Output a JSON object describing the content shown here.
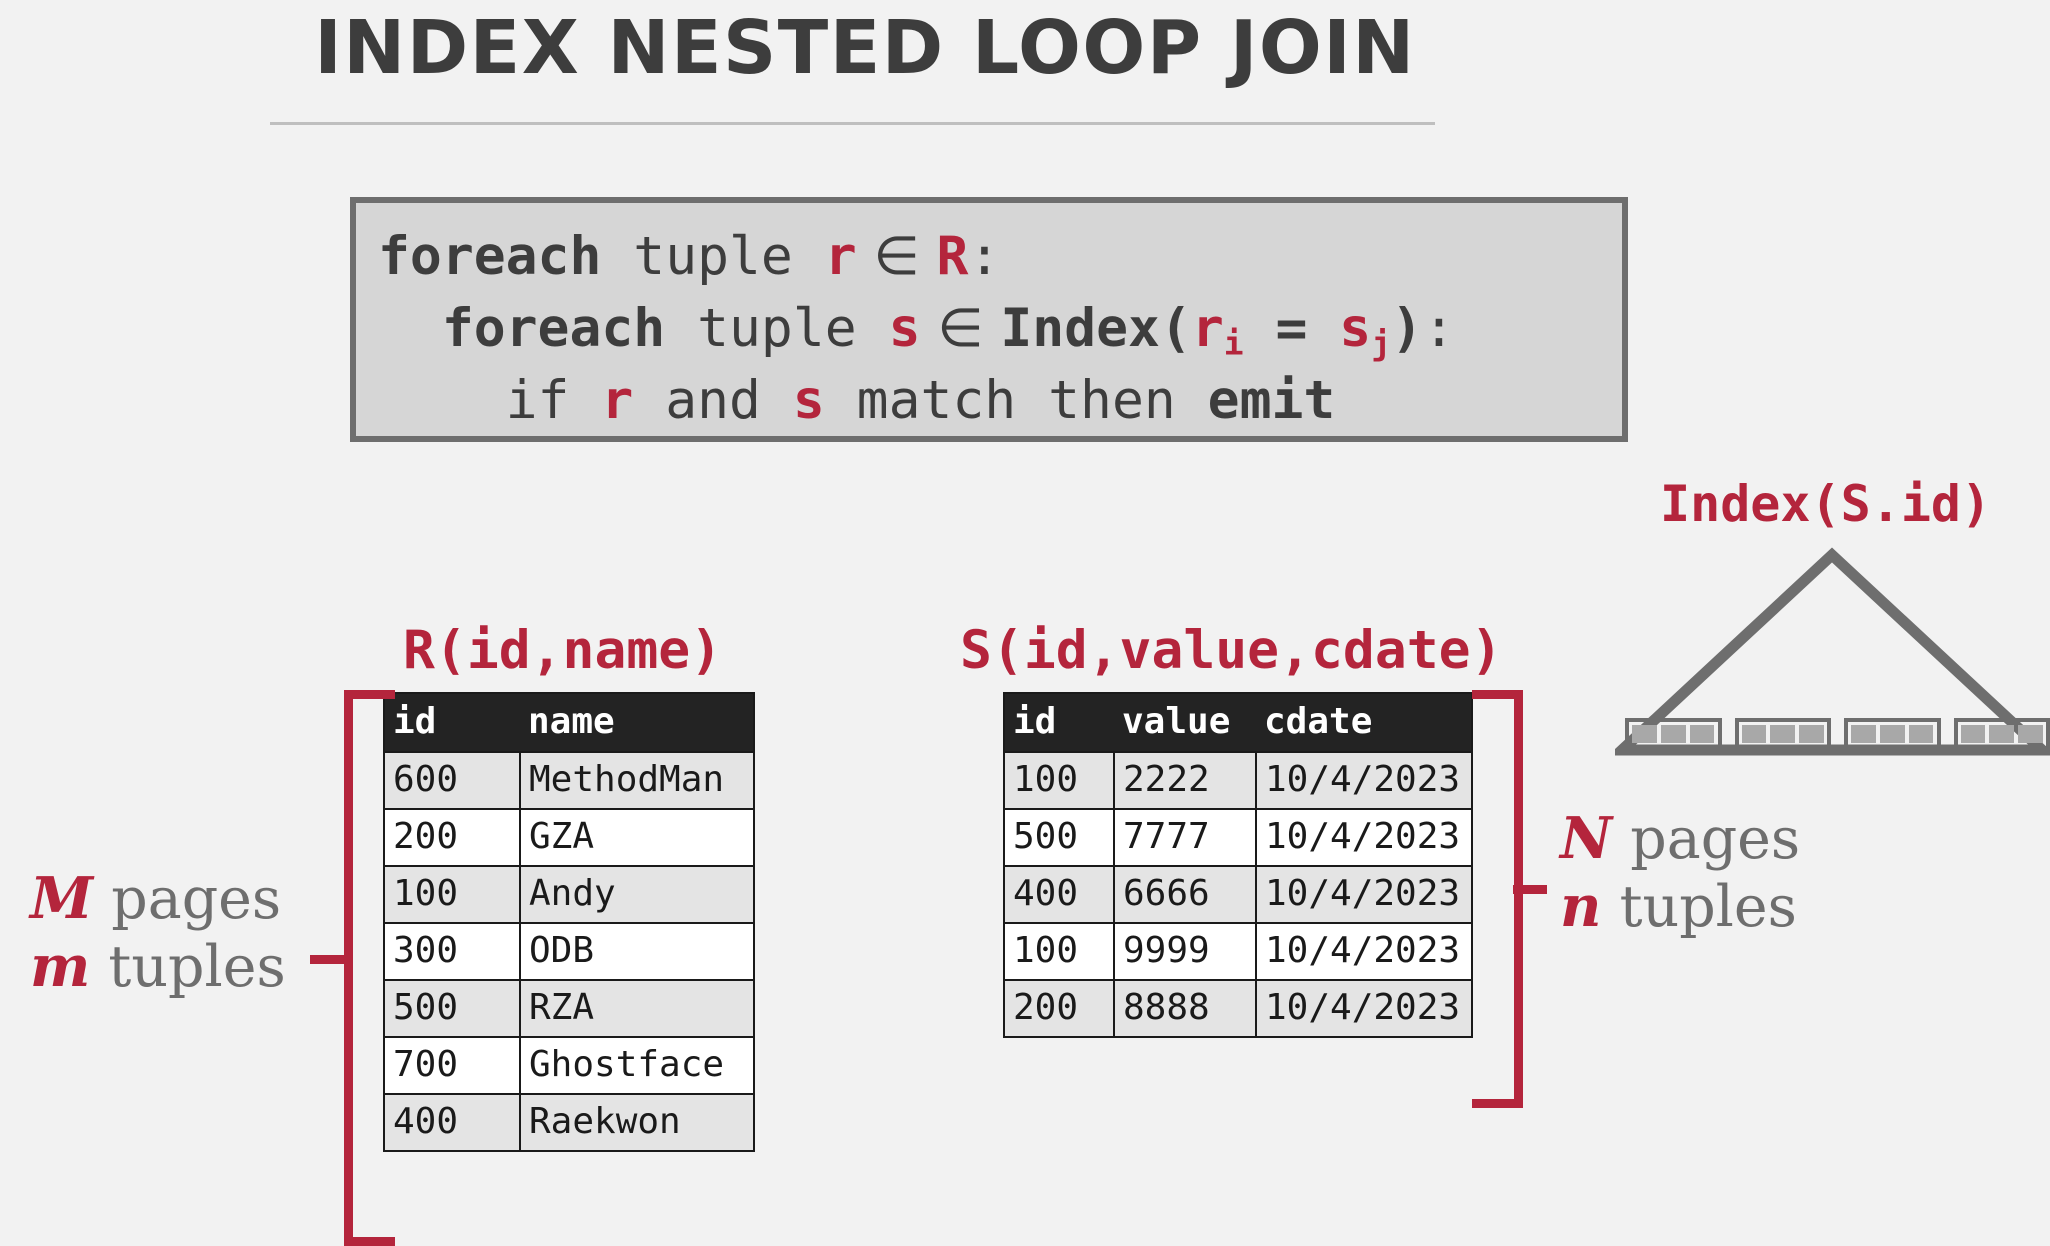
{
  "title": "INDEX NESTED LOOP JOIN",
  "pseudocode": {
    "line1": {
      "kw": "foreach",
      "t1": " tuple ",
      "v1": "r",
      "elem": " ∈ ",
      "v2": "R",
      "tail": ":"
    },
    "line2": {
      "indent": "  ",
      "kw": "foreach",
      "t1": " tuple ",
      "v1": "s",
      "elem": " ∈ ",
      "fn": "Index",
      "open": "(",
      "v2": "r",
      "sub2": "i",
      "eq": " = ",
      "v3": "s",
      "sub3": "j",
      "close": ")",
      "tail": ":"
    },
    "line3": {
      "indent": "    ",
      "kw1": "if ",
      "v1": "r",
      "t1": " and ",
      "v2": "s",
      "t2": " match then ",
      "kw2": "emit"
    }
  },
  "tables": {
    "r": {
      "caption": "R(id,name)",
      "columns": [
        "id",
        "name"
      ],
      "rows": [
        [
          "600",
          "MethodMan"
        ],
        [
          "200",
          "GZA"
        ],
        [
          "100",
          "Andy"
        ],
        [
          "300",
          "ODB"
        ],
        [
          "500",
          "RZA"
        ],
        [
          "700",
          "Ghostface"
        ],
        [
          "400",
          "Raekwon"
        ]
      ]
    },
    "s": {
      "caption": "S(id,value,cdate)",
      "columns": [
        "id",
        "value",
        "cdate"
      ],
      "rows": [
        [
          "100",
          "2222",
          "10/4/2023"
        ],
        [
          "500",
          "7777",
          "10/4/2023"
        ],
        [
          "400",
          "6666",
          "10/4/2023"
        ],
        [
          "100",
          "9999",
          "10/4/2023"
        ],
        [
          "200",
          "8888",
          "10/4/2023"
        ]
      ]
    }
  },
  "annotations": {
    "r": {
      "pages_sym": "M",
      "pages_label": " pages",
      "tuples_sym": "m",
      "tuples_label": " tuples"
    },
    "s": {
      "pages_sym": "N",
      "pages_label": " pages",
      "tuples_sym": "n",
      "tuples_label": " tuples"
    }
  },
  "index": {
    "label": "Index(S.id)",
    "leaf_groups": 4,
    "cells_per_group": 3
  },
  "colors": {
    "accent_red": "#b4253c",
    "header_dark": "#232323",
    "outline_gray": "#6e6e6e",
    "background": "#f2f2f2",
    "code_bg": "#d6d6d6"
  }
}
